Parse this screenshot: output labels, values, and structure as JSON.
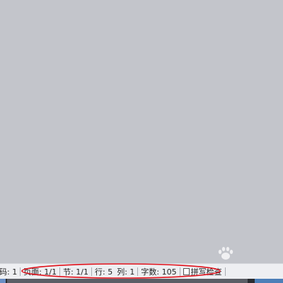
{
  "status_bar": {
    "code": "码: 1",
    "page": "页面: 1/1",
    "section": "节: 1/1",
    "row": "行: 5",
    "column": "列: 1",
    "word_count": "字数: 105",
    "spell_check": "拼写检查"
  },
  "watermark": {
    "brand": "Baidu经验"
  },
  "annotation": {
    "color": "#e0101a"
  },
  "colors": {
    "workspace": "#c3c5cb",
    "status_bar": "#eeeff2",
    "taskbar": "#3c3f46"
  }
}
